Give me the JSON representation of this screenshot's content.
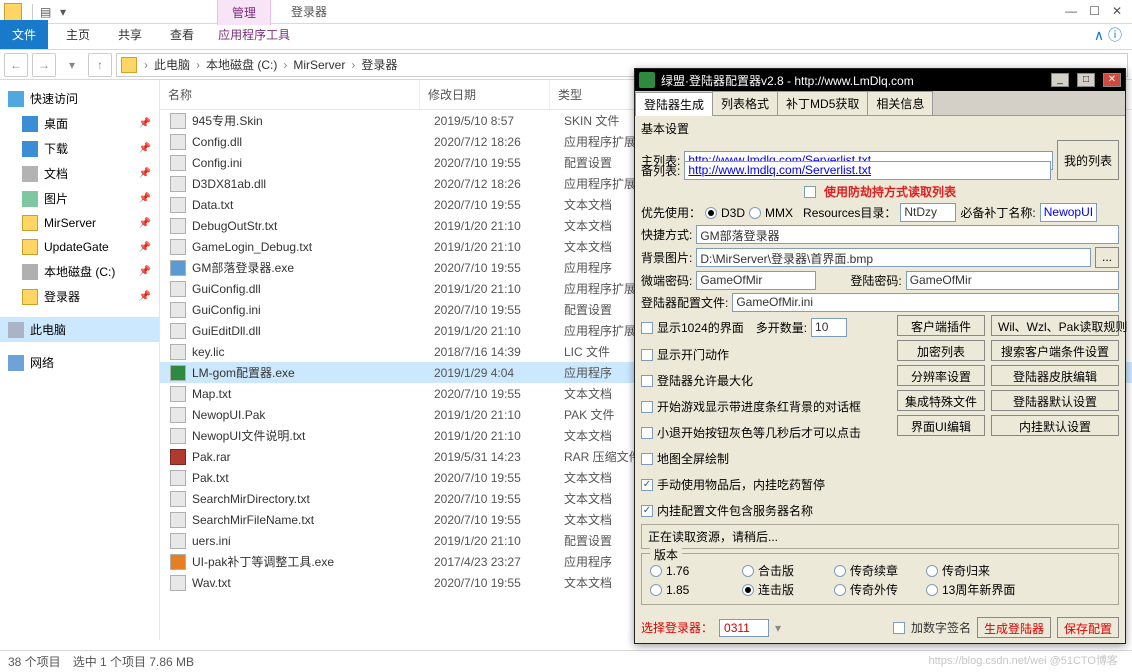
{
  "window": {
    "manage_tab": "管理",
    "app_tools": "应用程序工具",
    "title": "登录器"
  },
  "ribbon": {
    "file": "文件",
    "home": "主页",
    "share": "共享",
    "view": "查看",
    "help": "?"
  },
  "breadcrumbs": [
    "此电脑",
    "本地磁盘 (C:)",
    "MirServer",
    "登录器"
  ],
  "nav": {
    "quick": "快速访问",
    "desktop": "桌面",
    "downloads": "下载",
    "documents": "文档",
    "pictures": "图片",
    "mirserver": "MirServer",
    "updategate": "UpdateGate",
    "localdisk": "本地磁盘 (C:)",
    "loginer": "登录器",
    "thispc": "此电脑",
    "network": "网络"
  },
  "headers": {
    "name": "名称",
    "date": "修改日期",
    "type": "类型"
  },
  "files": [
    {
      "icon": "dll",
      "name": "945专用.Skin",
      "date": "2019/5/10 8:57",
      "type": "SKIN 文件"
    },
    {
      "icon": "dll",
      "name": "Config.dll",
      "date": "2020/7/12 18:26",
      "type": "应用程序扩展"
    },
    {
      "icon": "dll",
      "name": "Config.ini",
      "date": "2020/7/10 19:55",
      "type": "配置设置"
    },
    {
      "icon": "dll",
      "name": "D3DX81ab.dll",
      "date": "2020/7/12 18:26",
      "type": "应用程序扩展"
    },
    {
      "icon": "dll",
      "name": "Data.txt",
      "date": "2020/7/10 19:55",
      "type": "文本文档"
    },
    {
      "icon": "dll",
      "name": "DebugOutStr.txt",
      "date": "2019/1/20 21:10",
      "type": "文本文档"
    },
    {
      "icon": "dll",
      "name": "GameLogin_Debug.txt",
      "date": "2019/1/20 21:10",
      "type": "文本文档"
    },
    {
      "icon": "exe",
      "name": "GM部落登录器.exe",
      "date": "2020/7/10 19:55",
      "type": "应用程序"
    },
    {
      "icon": "dll",
      "name": "GuiConfig.dll",
      "date": "2019/1/20 21:10",
      "type": "应用程序扩展"
    },
    {
      "icon": "dll",
      "name": "GuiConfig.ini",
      "date": "2020/7/10 19:55",
      "type": "配置设置"
    },
    {
      "icon": "dll",
      "name": "GuiEditDll.dll",
      "date": "2019/1/20 21:10",
      "type": "应用程序扩展"
    },
    {
      "icon": "dll",
      "name": "key.lic",
      "date": "2018/7/16 14:39",
      "type": "LIC 文件"
    },
    {
      "icon": "green",
      "name": "LM-gom配置器.exe",
      "date": "2019/1/29 4:04",
      "type": "应用程序",
      "sel": true
    },
    {
      "icon": "dll",
      "name": "Map.txt",
      "date": "2020/7/10 19:55",
      "type": "文本文档"
    },
    {
      "icon": "dll",
      "name": "NewopUI.Pak",
      "date": "2019/1/20 21:10",
      "type": "PAK 文件"
    },
    {
      "icon": "dll",
      "name": "NewopUI文件说明.txt",
      "date": "2019/1/20 21:10",
      "type": "文本文档"
    },
    {
      "icon": "rar",
      "name": "Pak.rar",
      "date": "2019/5/31 14:23",
      "type": "RAR 压缩文件"
    },
    {
      "icon": "dll",
      "name": "Pak.txt",
      "date": "2020/7/10 19:55",
      "type": "文本文档"
    },
    {
      "icon": "dll",
      "name": "SearchMirDirectory.txt",
      "date": "2020/7/10 19:55",
      "type": "文本文档"
    },
    {
      "icon": "dll",
      "name": "SearchMirFileName.txt",
      "date": "2020/7/10 19:55",
      "type": "文本文档"
    },
    {
      "icon": "dll",
      "name": "uers.ini",
      "date": "2019/1/20 21:10",
      "type": "配置设置"
    },
    {
      "icon": "tool",
      "name": "UI-pak补丁等调整工具.exe",
      "date": "2017/4/23 23:27",
      "type": "应用程序"
    },
    {
      "icon": "dll",
      "name": "Wav.txt",
      "date": "2020/7/10 19:55",
      "type": "文本文档"
    }
  ],
  "status": {
    "items": "38 个项目",
    "selected": "选中 1 个项目 7.86 MB"
  },
  "dlg": {
    "title": "绿盟·登陆器配置器v2.8 - http://www.LmDlq.com",
    "tabs": [
      "登陆器生成",
      "列表格式",
      "补丁MD5获取",
      "相关信息"
    ],
    "basic": "基本设置",
    "main_list_lbl": "主列表:",
    "main_list": "http://www.lmdlq.com/Serverlist.txt",
    "back_list_lbl": "备列表:",
    "back_list": "http://www.lmdlq.com/Serverlist.txt",
    "mylist": "我的列表",
    "anti": "使用防劫持方式读取列表",
    "prefer": "优先使用：",
    "d3d": "D3D",
    "mmx": "MMX",
    "resdir": "Resources目录：",
    "resdir_v": "NtDzy",
    "patch_lbl": "必备补丁名称:",
    "patch_v": "NewopUI",
    "shortcut_lbl": "快捷方式:",
    "shortcut_v": "GM部落登录器",
    "bg_lbl": "背景图片:",
    "bg_v": "D:\\MirServer\\登录器\\首界面.bmp",
    "browse": "...",
    "micro_lbl": "微端密码:",
    "micro_v": "GameOfMir",
    "login_lbl": "登陆密码:",
    "login_v": "GameOfMir",
    "cfg_lbl": "登陆器配置文件:",
    "cfg_v": "GameOfMir.ini",
    "cb": [
      "显示1024的界面",
      "显示开门动作",
      "登陆器允许最大化",
      "开始游戏显示带进度条红背景的对话框",
      "小退开始按钮灰色等几秒后才可以点击",
      "地图全屏绘制",
      "手动使用物品后，内挂吃药暂停",
      "内挂配置文件包含服务器名称"
    ],
    "cb_state": [
      false,
      false,
      false,
      false,
      false,
      false,
      true,
      true
    ],
    "multi_lbl": "多开数量:",
    "multi_v": "10",
    "btns1": [
      "客户端插件",
      "加密列表",
      "分辨率设置",
      "集成特殊文件",
      "界面UI编辑"
    ],
    "btns2": [
      "Wil、Wzl、Pak读取规则",
      "搜索客户端条件设置",
      "登陆器皮肤编辑",
      "登陆器默认设置",
      "内挂默认设置"
    ],
    "reading": "正在读取资源，请稍后...",
    "ver": "版本",
    "vrow1": [
      "1.76",
      "合击版",
      "传奇续章",
      "传奇归来"
    ],
    "vrow2": [
      "1.85",
      "连击版",
      "传奇外传",
      "13周年新界面"
    ],
    "vsel": "连击版",
    "choose": "选择登录器：",
    "choose_v": "0311",
    "signnum": "加数字签名",
    "gen": "生成登陆器",
    "save": "保存配置"
  },
  "watermark": "https://blog.csdn.net/wei  @51CTO博客"
}
